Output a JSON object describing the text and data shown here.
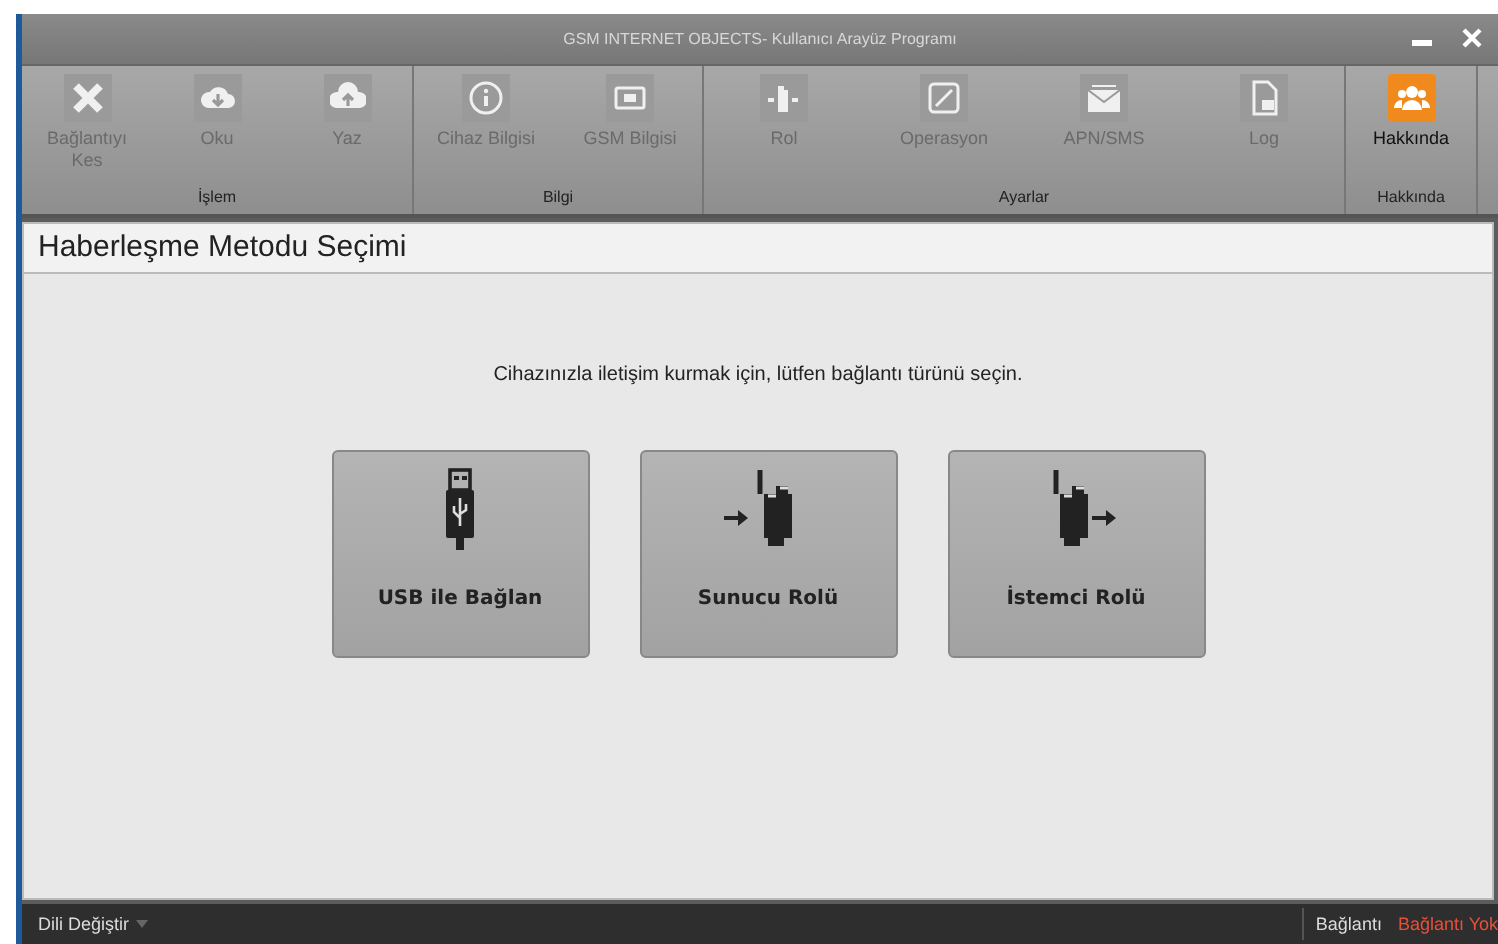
{
  "window": {
    "title": "GSM INTERNET OBJECTS- Kullanıcı Arayüz Programı"
  },
  "ribbon": {
    "groups": [
      {
        "label": "İşlem",
        "buttons": [
          {
            "label": "Bağlantıyı Kes",
            "kind": "close",
            "disabled": true
          },
          {
            "label": "Oku",
            "kind": "download",
            "disabled": true
          },
          {
            "label": "Yaz",
            "kind": "upload",
            "disabled": true
          }
        ]
      },
      {
        "label": "Bilgi",
        "buttons": [
          {
            "label": "Cihaz Bilgisi",
            "kind": "info",
            "disabled": true
          },
          {
            "label": "GSM Bilgisi",
            "kind": "sim",
            "disabled": true
          }
        ]
      },
      {
        "label": "Ayarlar",
        "buttons": [
          {
            "label": "Rol",
            "kind": "role",
            "disabled": true
          },
          {
            "label": "Operasyon",
            "kind": "edit",
            "disabled": true
          },
          {
            "label": "APN/SMS",
            "kind": "mail",
            "disabled": true
          },
          {
            "label": "Log",
            "kind": "log",
            "disabled": true
          }
        ]
      },
      {
        "label": "Hakkında",
        "buttons": [
          {
            "label": "Hakkında",
            "kind": "people",
            "disabled": false
          }
        ]
      }
    ]
  },
  "panel": {
    "title": "Haberleşme Metodu Seçimi",
    "message": "Cihazınızla iletişim kurmak için, lütfen bağlantı türünü seçin.",
    "options": [
      {
        "label": "USB ile Bağlan",
        "kind": "usb"
      },
      {
        "label": "Sunucu Rolü",
        "kind": "server"
      },
      {
        "label": "İstemci Rolü",
        "kind": "client"
      }
    ]
  },
  "status_bar": {
    "language": "Dili Değiştir",
    "connection_label": "Bağlantı",
    "connection_value": "Bağlantı Yok"
  }
}
